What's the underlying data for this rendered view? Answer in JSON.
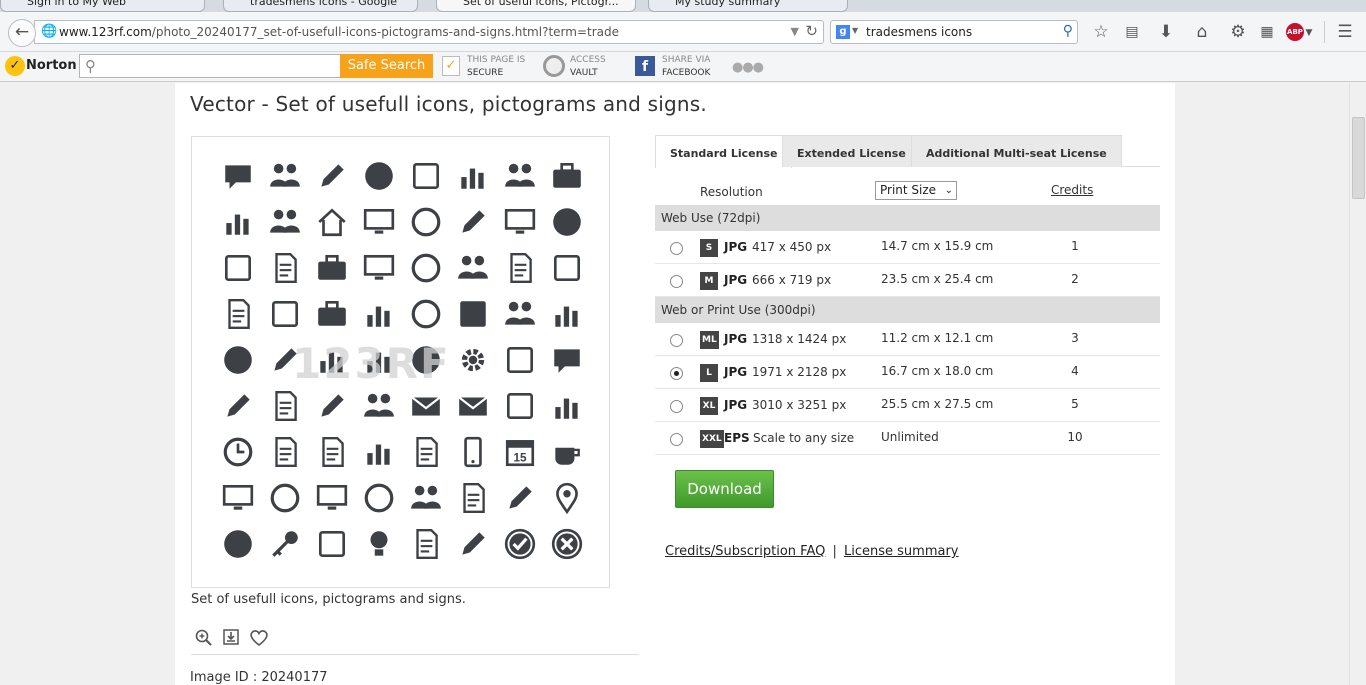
{
  "browser": {
    "tabs": [
      {
        "label": "Sign in to My Web"
      },
      {
        "label": "tradesmens icons - Google"
      },
      {
        "label": "Set of useful icons, Pictogr..."
      },
      {
        "label": "My study summary"
      }
    ],
    "url_host": "www.123rf.com",
    "url_path": "/photo_20240177_set-of-usefull-icons-pictograms-and-signs.html?term=trade",
    "search_query": "tradesmens icons",
    "search_engine_icon": "google-icon"
  },
  "norton": {
    "brand": "Norton",
    "search_placeholder": "",
    "safe_search_label": "Safe Search",
    "secure_line1": "THIS PAGE IS",
    "secure_line2": "SECURE",
    "vault_line1": "ACCESS",
    "vault_line2": "VAULT",
    "facebook_line1": "SHARE VIA",
    "facebook_line2": "FACEBOOK"
  },
  "page": {
    "title": "Vector - Set of usefull icons, pictograms and signs.",
    "watermark": "123RF",
    "caption": "Set of usefull icons, pictograms and signs.",
    "image_id": "Image ID : 20240177",
    "icons": [
      "money-chat-icon",
      "people-icon",
      "pencil-icon",
      "piggy-bank-icon",
      "id-card-icon",
      "building-icon",
      "binoculars-icon",
      "briefcase-icon",
      "bank-icon",
      "businessman-icon",
      "house-icon",
      "presentation-chart-icon",
      "target-icon",
      "megaphone-icon",
      "monitor-chart-icon",
      "bird-icon",
      "calculator-icon",
      "clipboard-icon",
      "toolbox-icon",
      "laptop-money-icon",
      "globe-icon",
      "team-icon",
      "notebook-icon",
      "picture-icon",
      "document-icon",
      "tablet-icon",
      "suitcase-icon",
      "shopping-cart-icon",
      "magnifier-icon",
      "credit-card-icon",
      "support-agent-icon",
      "binders-icon",
      "pie-chart-icon",
      "pushpin-icon",
      "growth-chart-icon",
      "decline-chart-icon",
      "money-bag-icon",
      "gears-icon",
      "floppy-disk-icon",
      "chat-bubbles-icon",
      "paperclip-icon",
      "organizer-icon",
      "tag-icon",
      "handshake-icon",
      "envelope-icon",
      "open-envelope-icon",
      "banknote-icon",
      "org-chart-icon",
      "clock-icon",
      "document-check-icon",
      "document-cancel-icon",
      "bar-chart-icon",
      "newspaper-icon",
      "smartphone-icon",
      "calendar-icon",
      "coffee-cup-icon",
      "easel-chart-icon",
      "bullseye-icon",
      "laptop-icon",
      "refresh-icon",
      "glasses-mustache-icon",
      "clipboard-list-icon",
      "pen-icon",
      "location-pin-icon",
      "mouse-icon",
      "key-icon",
      "calculator-alt-icon",
      "lightbulb-icon",
      "contract-sign-icon",
      "usb-drive-icon",
      "check-circle-icon",
      "close-circle-icon"
    ],
    "calendar_day": "15",
    "actions": [
      "zoom-in-icon",
      "download-comp-icon",
      "heart-icon"
    ]
  },
  "license": {
    "tabs": [
      "Standard License",
      "Extended License",
      "Additional Multi-seat License"
    ],
    "active_tab": 0,
    "resolution_label": "Resolution",
    "size_select": "Print Size",
    "credits_label": "Credits",
    "groups": [
      {
        "label": "Web Use (72dpi)",
        "rows": [
          {
            "badge": "S",
            "format": "JPG",
            "pixels": "417 x 450 px",
            "print": "14.7 cm x 15.9 cm",
            "credits": "1",
            "selected": false
          },
          {
            "badge": "M",
            "format": "JPG",
            "pixels": "666 x 719 px",
            "print": "23.5 cm x 25.4 cm",
            "credits": "2",
            "selected": false
          }
        ]
      },
      {
        "label": "Web or Print Use (300dpi)",
        "rows": [
          {
            "badge": "ML",
            "format": "JPG",
            "pixels": "1318 x 1424 px",
            "print": "11.2 cm x 12.1 cm",
            "credits": "3",
            "selected": false
          },
          {
            "badge": "L",
            "format": "JPG",
            "pixels": "1971 x 2128 px",
            "print": "16.7 cm x 18.0 cm",
            "credits": "4",
            "selected": true
          },
          {
            "badge": "XL",
            "format": "JPG",
            "pixels": "3010 x 3251 px",
            "print": "25.5 cm x 27.5 cm",
            "credits": "5",
            "selected": false
          },
          {
            "badge": "XXL",
            "format": "EPS",
            "pixels": "Scale to any size",
            "print": "Unlimited",
            "credits": "10",
            "selected": false
          }
        ]
      }
    ],
    "download_label": "Download",
    "faq_link": "Credits/Subscription FAQ",
    "divider": "|",
    "summary_link": "License summary"
  },
  "colors": {
    "download_green": "#4fae36",
    "icon_dark": "#3d4045",
    "safe_search_orange": "#f7a21b",
    "norton_yellow": "#ffc20e"
  }
}
